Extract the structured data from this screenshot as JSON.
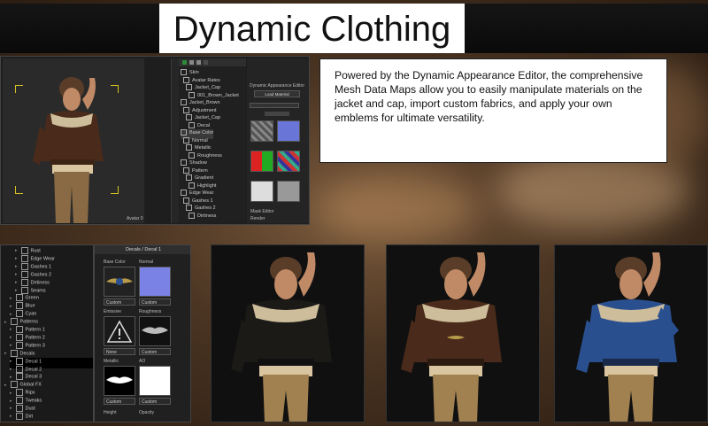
{
  "title": "Dynamic Clothing",
  "description": "Powered by the Dynamic Appearance Editor, the comprehensive Mesh Data Maps allow you to easily manipulate materials on the jacket and cap, import custom fabrics, and apply your own emblems for ultimate versatility.",
  "colors": {
    "title_bg": "#0f0f0f",
    "title_text": "#111111",
    "panel_bg": "#1b1b1b",
    "jacket_black": "#1c1a17",
    "jacket_brown": "#4a2a1a",
    "jacket_blue": "#2a4f8f"
  },
  "top_panel": {
    "viewport_label": "Avatar 0",
    "editor_header": "Dynamic Appearance Editor",
    "tree_items": [
      "Skin",
      "Avatar Rates",
      "Jacket_Cap",
      "001_Brown_Jacket",
      "Jacket_Brown",
      "Adjustment",
      "Jacket_Cap",
      "Decal",
      "Base Color",
      "Normal",
      "Metallic",
      "Roughness",
      "Shadow",
      "Pattern",
      "Gradient",
      "Highlight",
      "Edge Wear",
      "Gashes 1",
      "Gashes 2",
      "Dirtiness"
    ],
    "button_label": "Load Material",
    "footer_items": [
      "Mask Editor",
      "Render"
    ]
  },
  "left_tree": {
    "rows": [
      {
        "label": "Rust",
        "indent": 2
      },
      {
        "label": "Edge Wear",
        "indent": 2
      },
      {
        "label": "Gashes 1",
        "indent": 2
      },
      {
        "label": "Gashes 2",
        "indent": 2
      },
      {
        "label": "Dirtiness",
        "indent": 2
      },
      {
        "label": "Seams",
        "indent": 2
      },
      {
        "label": "Green",
        "indent": 1
      },
      {
        "label": "Blue",
        "indent": 1
      },
      {
        "label": "Cyan",
        "indent": 1
      },
      {
        "label": "Patterns",
        "indent": 0
      },
      {
        "label": "Pattern 1",
        "indent": 1
      },
      {
        "label": "Pattern 2",
        "indent": 1
      },
      {
        "label": "Pattern 3",
        "indent": 1
      },
      {
        "label": "Decals",
        "indent": 0
      },
      {
        "label": "Decal 1",
        "indent": 1,
        "selected": true
      },
      {
        "label": "Decal 2",
        "indent": 1
      },
      {
        "label": "Decal 3",
        "indent": 1
      },
      {
        "label": "Global FX",
        "indent": 0
      },
      {
        "label": "Rips",
        "indent": 1
      },
      {
        "label": "Tweaks",
        "indent": 1
      },
      {
        "label": "Dust",
        "indent": 1
      },
      {
        "label": "Dirt",
        "indent": 1
      }
    ]
  },
  "decal_panel": {
    "header": "Decals / Decal 1",
    "base_color": "Base Color",
    "normal": "Normal",
    "emissive": "Emissive",
    "roughness": "Roughness",
    "metallic": "Metallic",
    "ao": "AO",
    "height": "Height",
    "opacity": "Opacity",
    "dd_custom": "Custom",
    "dd_none": "None"
  }
}
